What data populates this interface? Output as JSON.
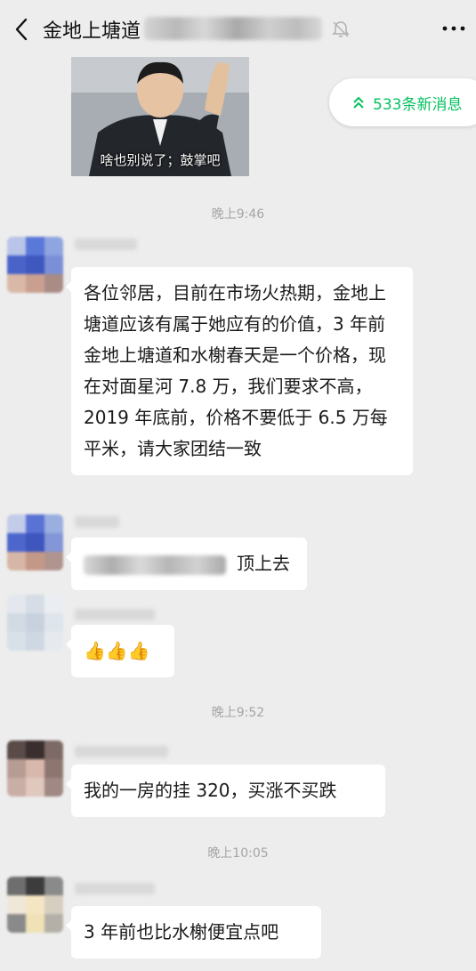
{
  "header": {
    "title": "金地上塘道",
    "back_icon": "chevron-left-icon",
    "mute_icon": "bell-muted-icon",
    "more_icon": "more-dots-icon"
  },
  "sticker": {
    "caption": "啥也别说了；鼓掌吧"
  },
  "new_messages": {
    "label": "533条新消息",
    "icon": "double-chevron-up-icon",
    "color": "#07c160"
  },
  "timestamps": [
    "晚上9:46",
    "晚上9:52",
    "晚上10:05"
  ],
  "messages": [
    {
      "text": "各位邻居，目前在市场火热期，金地上塘道应该有属于她应有的价值，3 年前金地上塘道和水榭春天是一个价格，现在对面星河 7.8 万，我们要求不高，2019 年底前，价格不要低于 6.5 万每平米，请大家团结一致"
    },
    {
      "text": "顶上去"
    },
    {
      "text": "👍👍👍"
    },
    {
      "text": "我的一房的挂 320，买涨不买跌"
    },
    {
      "text": "3 年前也比水榭便宜点吧"
    }
  ]
}
